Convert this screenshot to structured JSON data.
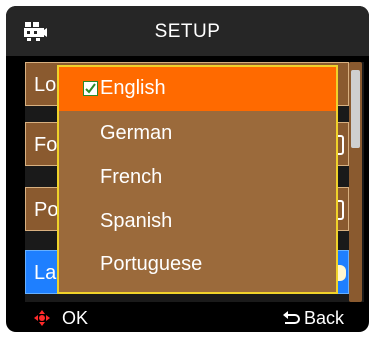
{
  "header": {
    "title": "SETUP",
    "icon": "camera-icon"
  },
  "menu": {
    "items": [
      {
        "label": "Lo",
        "state": "normal"
      },
      {
        "label": "Fo",
        "state": "normal"
      },
      {
        "label": "Po",
        "state": "normal"
      },
      {
        "label": "La",
        "state": "active"
      }
    ]
  },
  "language_dropdown": {
    "options": [
      {
        "label": "English",
        "selected": true
      },
      {
        "label": "German",
        "selected": false
      },
      {
        "label": "French",
        "selected": false
      },
      {
        "label": "Spanish",
        "selected": false
      },
      {
        "label": "Portuguese",
        "selected": false
      }
    ]
  },
  "footer": {
    "ok_label": "OK",
    "back_label": "Back",
    "ok_icon": "dpad-icon",
    "back_icon": "return-arrow-icon"
  },
  "colors": {
    "header_bg": "#262626",
    "menu_row_bg": "#8a5a2f",
    "active_row_bg": "#1e7fff",
    "dropdown_bg": "#9b6a3b",
    "dropdown_border": "#f0d22a",
    "selected_option_bg": "#ff6a00",
    "dpad_icon": "#ff2a2a"
  }
}
